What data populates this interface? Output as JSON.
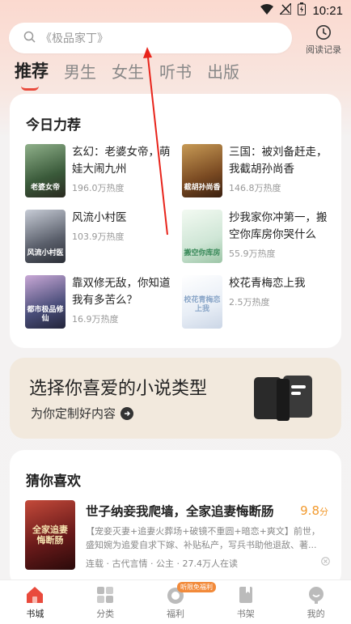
{
  "status": {
    "time": "10:21"
  },
  "search": {
    "placeholder": "《极品家丁》"
  },
  "history": {
    "label": "阅读记录"
  },
  "tabs": [
    {
      "label": "推荐"
    },
    {
      "label": "男生"
    },
    {
      "label": "女生"
    },
    {
      "label": "听书"
    },
    {
      "label": "出版"
    }
  ],
  "daily": {
    "title": "今日力荐",
    "books": [
      {
        "title": "玄幻：老婆女帝，萌娃大闹九州",
        "heat": "196.0万热度",
        "cover_text": "老婆女帝",
        "cover_color": "#3a5a3a"
      },
      {
        "title": "三国：被刘备赶走，我截胡孙尚香",
        "heat": "146.8万热度",
        "cover_text": "截胡孙尚香",
        "cover_color": "#7a4a22"
      },
      {
        "title": "风流小村医",
        "heat": "103.9万热度",
        "cover_text": "风流小村医",
        "cover_color": "#5a5f6b"
      },
      {
        "title": "抄我家你冲第一，搬空你库房你哭什么",
        "heat": "55.9万热度",
        "cover_text": "搬空你库房",
        "cover_color": "#cfe6d6"
      },
      {
        "title": "靠双修无敌，你知道我有多苦么？",
        "heat": "16.9万热度",
        "cover_text": "都市极品修仙",
        "cover_color": "#4a4e7a"
      },
      {
        "title": "校花青梅恋上我",
        "heat": "2.5万热度",
        "cover_text": "校花青梅恋上我",
        "cover_color": "#e8eef6"
      }
    ]
  },
  "banner": {
    "title": "选择你喜爱的小说类型",
    "subtitle": "为你定制好内容"
  },
  "guess": {
    "title": "猜你喜欢",
    "item": {
      "title": "世子纳妾我爬墙，全家追妻悔断肠",
      "score": "9.8",
      "score_unit": "分",
      "desc": "【宠妾灭妻+追妻火葬场+破镜不重圆+暗恋+爽文】前世，盛知婉为追爱自求下嫁、补贴私产，写兵书助他退敌、著...",
      "meta": "连载 · 古代言情 · 公主 · 27.4万人在读",
      "cover_text": "全家追妻悔断肠",
      "cover_color": "#6a1a1a"
    }
  },
  "nav": [
    {
      "label": "书城",
      "icon": "home-icon"
    },
    {
      "label": "分类",
      "icon": "category-icon"
    },
    {
      "label": "福利",
      "icon": "gift-icon",
      "badge": "听限免福利"
    },
    {
      "label": "书架",
      "icon": "bookshelf-icon"
    },
    {
      "label": "我的",
      "icon": "profile-icon"
    }
  ],
  "colors": {
    "accent": "#e94a3c",
    "score": "#f29a2e"
  }
}
